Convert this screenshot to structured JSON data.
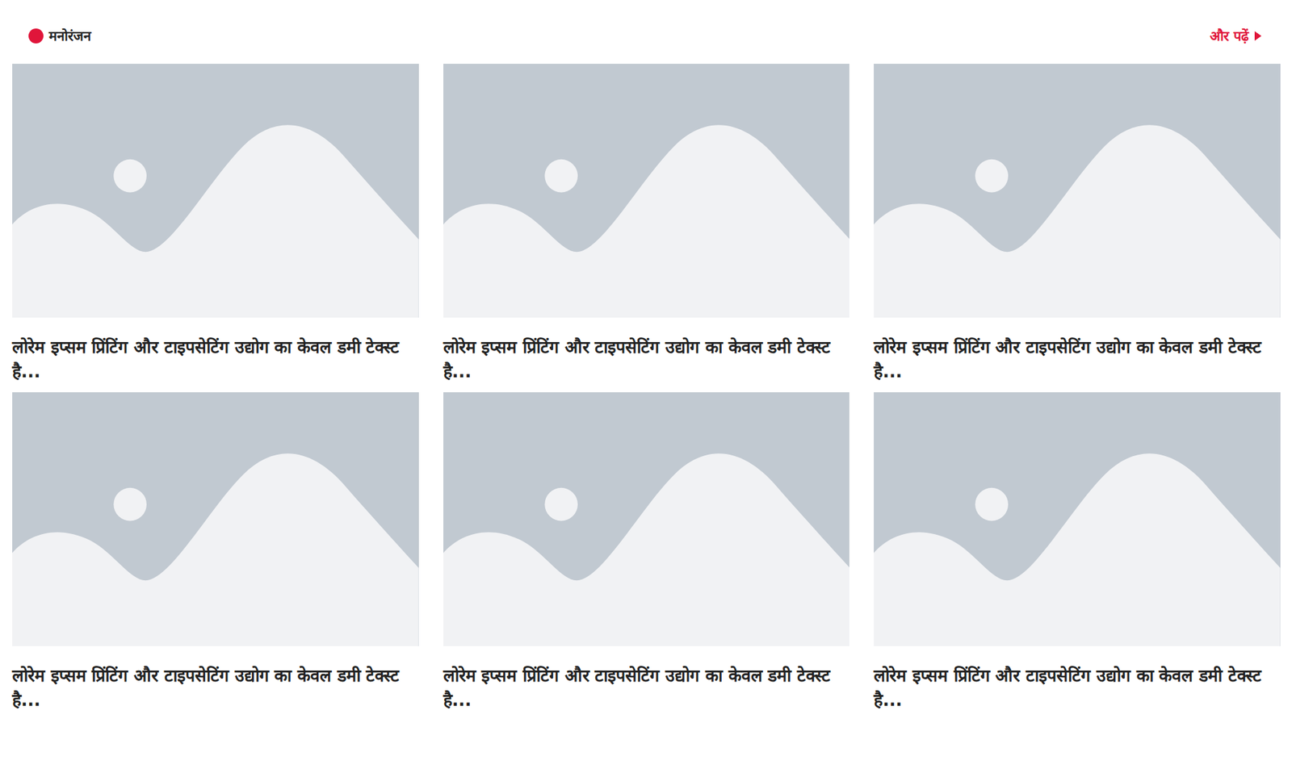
{
  "section": {
    "title": "मनोरंजन",
    "more": "और पढ़ें"
  },
  "articles": [
    {
      "title": "लोरेम इप्सम प्रिंटिंग और टाइपसेटिंग उद्योग का केवल डमी टेक्स्ट है..."
    },
    {
      "title": "लोरेम इप्सम प्रिंटिंग और टाइपसेटिंग उद्योग का केवल डमी टेक्स्ट है..."
    },
    {
      "title": "लोरेम इप्सम प्रिंटिंग और टाइपसेटिंग उद्योग का केवल डमी टेक्स्ट है..."
    },
    {
      "title": "लोरेम इप्सम प्रिंटिंग और टाइपसेटिंग उद्योग का केवल डमी टेक्स्ट है..."
    },
    {
      "title": "लोरेम इप्सम प्रिंटिंग और टाइपसेटिंग उद्योग का केवल डमी टेक्स्ट है..."
    },
    {
      "title": "लोरेम इप्सम प्रिंटिंग और टाइपसेटिंग उद्योग का केवल डमी टेक्स्ट है..."
    }
  ]
}
